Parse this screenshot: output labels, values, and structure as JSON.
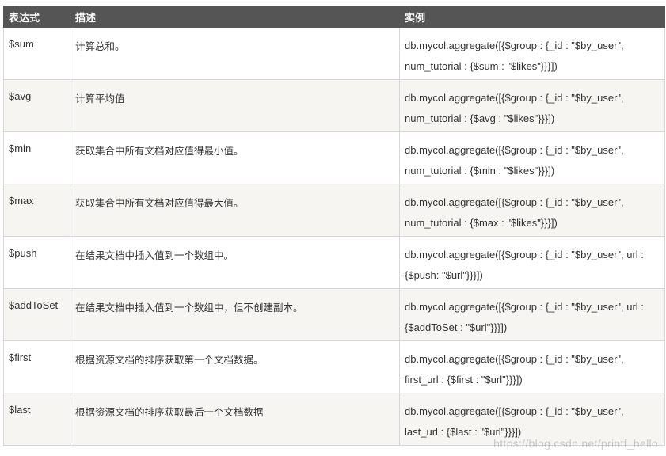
{
  "table": {
    "headers": [
      "表达式",
      "描述",
      "实例"
    ],
    "rows": [
      {
        "expr": "$sum",
        "desc": "计算总和。",
        "example": [
          "db.mycol.aggregate([{$group : {_id : \"$by_user\",",
          "num_tutorial : {$sum : \"$likes\"}}}])"
        ]
      },
      {
        "expr": "$avg",
        "desc": "计算平均值",
        "example": [
          "db.mycol.aggregate([{$group : {_id : \"$by_user\",",
          "num_tutorial : {$avg : \"$likes\"}}}])"
        ]
      },
      {
        "expr": "$min",
        "desc": "获取集合中所有文档对应值得最小值。",
        "example": [
          "db.mycol.aggregate([{$group : {_id : \"$by_user\",",
          "num_tutorial : {$min : \"$likes\"}}}])"
        ]
      },
      {
        "expr": "$max",
        "desc": "获取集合中所有文档对应值得最大值。",
        "example": [
          "db.mycol.aggregate([{$group : {_id : \"$by_user\",",
          "num_tutorial : {$max : \"$likes\"}}}])"
        ]
      },
      {
        "expr": "$push",
        "desc": "在结果文档中插入值到一个数组中。",
        "example": [
          "db.mycol.aggregate([{$group : {_id : \"$by_user\", url :",
          "{$push: \"$url\"}}}])"
        ]
      },
      {
        "expr": "$addToSet",
        "desc": "在结果文档中插入值到一个数组中，但不创建副本。",
        "example": [
          "db.mycol.aggregate([{$group : {_id : \"$by_user\", url :",
          "{$addToSet : \"$url\"}}}])"
        ]
      },
      {
        "expr": "$first",
        "desc": "根据资源文档的排序获取第一个文档数据。",
        "example": [
          "db.mycol.aggregate([{$group : {_id : \"$by_user\",",
          "first_url : {$first : \"$url\"}}}])"
        ]
      },
      {
        "expr": "$last",
        "desc": "根据资源文档的排序获取最后一个文档数据",
        "example": [
          "db.mycol.aggregate([{$group : {_id : \"$by_user\",",
          "last_url : {$last : \"$url\"}}}])"
        ]
      }
    ]
  },
  "watermark": "https://blog.csdn.net/printf_hello"
}
